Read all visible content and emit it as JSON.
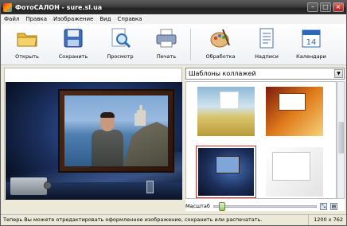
{
  "window": {
    "title": "ФотоСАЛОН - sure.sl.ua"
  },
  "menu": [
    "Файл",
    "Правка",
    "Изображение",
    "Вид",
    "Справка"
  ],
  "toolbar": {
    "open": "Открыть",
    "save": "Сохранить",
    "preview": "Просмотр",
    "print": "Печать",
    "process": "Обработка",
    "captions": "Надписи",
    "calendars": "Календари"
  },
  "templates": {
    "dropdown_value": "Шаблоны коллажей"
  },
  "scale": {
    "label": "Масштаб",
    "level_fraction": 0.05
  },
  "status": {
    "message": "Теперь Вы можете отредактировать оформленное изображение, сохранить или распечатать.",
    "resolution": "1200 x 762"
  },
  "colors": {
    "selection_border": "#cc3333",
    "titlebar": "#2e2e2e"
  }
}
